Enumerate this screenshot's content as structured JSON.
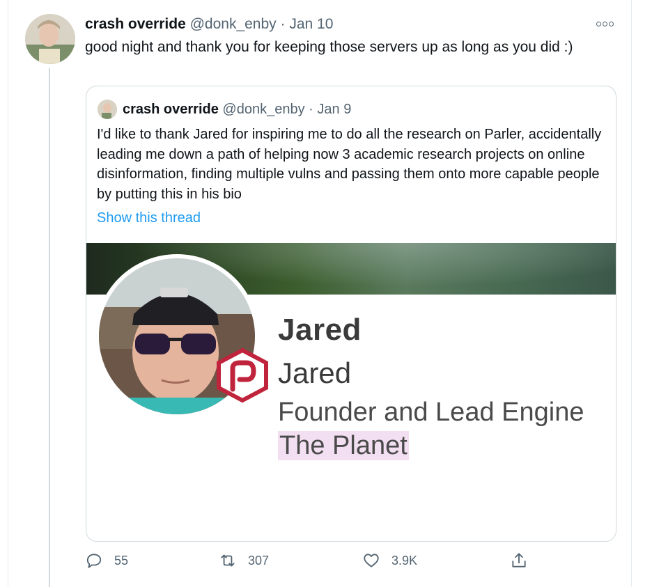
{
  "tweet": {
    "author_name": "crash override",
    "author_handle": "@donk_enby",
    "separator": "·",
    "date": "Jan 10",
    "text": "good night and thank you for keeping those servers up as long as you did :)"
  },
  "quoted": {
    "author_name": "crash override",
    "author_handle": "@donk_enby",
    "separator": "·",
    "date": "Jan 9",
    "text": "I'd like to thank Jared for inspiring me to do all the research on Parler, accidentally leading me down a path of helping now 3 academic research projects on online disinformation, finding multiple vulns and passing them onto more capable people by putting this in his bio",
    "show_thread": "Show this thread",
    "image": {
      "display_name": "Jared",
      "username": "Jared",
      "bio": "Founder and Lead Engine",
      "location": "The Planet",
      "badge_letter": "P",
      "badge_color": "#c0243c"
    }
  },
  "actions": {
    "reply_count": "55",
    "retweet_count": "307",
    "like_count": "3.9K"
  },
  "icons": [
    "more-icon",
    "reply-icon",
    "retweet-icon",
    "like-icon",
    "share-icon"
  ],
  "colors": {
    "link": "#1d9bf0",
    "secondary_text": "#536471",
    "border": "#cfd9de",
    "highlight": "#f2dff1"
  }
}
